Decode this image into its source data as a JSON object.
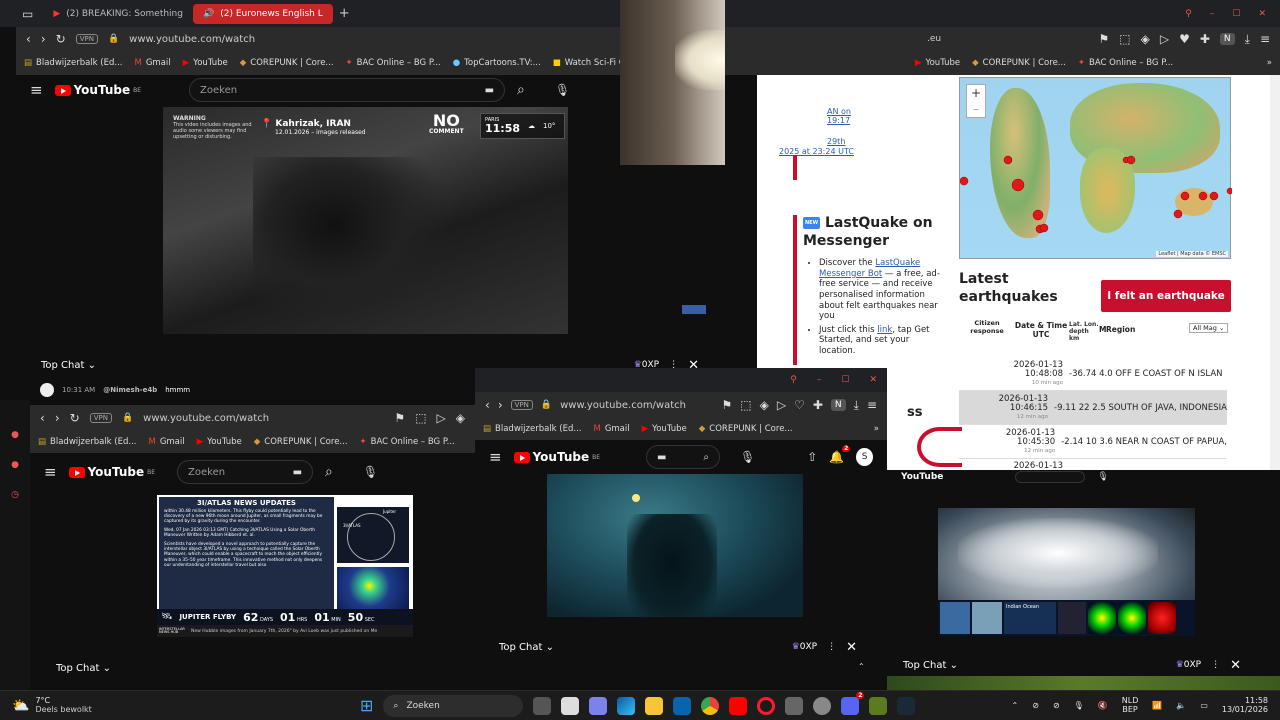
{
  "top_left": {
    "tabs": [
      {
        "label": "(2) BREAKING: Something"
      },
      {
        "label": "(2) Euronews English L"
      }
    ],
    "new_tab": "+",
    "url": "www.youtube.com/watch",
    "vpn": "VPN",
    "bookmarks": [
      "Bladwijzerbalk (Ed...",
      "Gmail",
      "YouTube",
      "COREPUNK | Core...",
      "BAC Online – BG P...",
      "TopCartoons.TV:...",
      "Watch Sci-Fi Carto"
    ],
    "search_placeholder": "Zoeken",
    "country": "BE",
    "video": {
      "warning_title": "WARNING",
      "warning_text": "This video includes images and audio some viewers may find upsetting or disturbing.",
      "location": "Kahrizak, IRAN",
      "date": "12.01.2026 – images released",
      "brand_top": "NO",
      "brand_bottom": "COMMENT",
      "city": "PARIS",
      "time": "11:58",
      "temp": "10°"
    },
    "chat": {
      "label": "Top Chat",
      "xp": "0XP",
      "time": "10:31 AM",
      "user": "@Nimesh-e4b",
      "message": "hmmm"
    }
  },
  "right_window": {
    "url_tail": ".eu",
    "bookmarks": [
      "YouTube",
      "COREPUNK | Core...",
      "BAC Online – BG P..."
    ],
    "profile_initial": "N",
    "links": [
      "AN on",
      "19:17",
      "29th",
      "2025 at 23:24 UTC"
    ],
    "messenger_badge": "NEW",
    "messenger_title": "LastQuake on Messenger",
    "bullets": [
      {
        "pre": "Discover the ",
        "link": "LastQuake Messenger Bot",
        "post": " — a free, ad-free service — and receive personalised information about felt earthquakes near you"
      },
      {
        "pre": "Just click this ",
        "link": "link",
        "post": ", tap Get Started, and set your location."
      }
    ],
    "map_attrib": "Leaflet | Map data © EMSC",
    "latest_title": "Latest earthquakes",
    "felt_button": "I felt an earthquake",
    "columns": [
      "Citizen response",
      "Date & Time UTC",
      "Lat. Lon. depth km",
      "M",
      "Region"
    ],
    "filter": "All Mag",
    "rows": [
      {
        "date": "2026-01-13",
        "time": "10:48:08",
        "ago": "10 min ago",
        "vals": "-36.74 4.0 OFF E COAST OF N ISLAN"
      },
      {
        "date": "2026-01-13",
        "time": "10:46:15",
        "ago": "12 min ago",
        "vals": "-9.11 22 2.5 SOUTH OF JAVA, INDONESIA"
      },
      {
        "date": "2026-01-13",
        "time": "10:45:30",
        "ago": "12 min ago",
        "vals": "-2.14 10 3.6 NEAR N COAST OF PAPUA,"
      },
      {
        "date": "2026-01-13",
        "time": "",
        "ago": "",
        "vals": ""
      }
    ],
    "partial_heading": "ss"
  },
  "bottom_left": {
    "url": "www.youtube.com/watch",
    "vpn": "VPN",
    "bookmarks": [
      "Bladwijzerbalk (Ed...",
      "Gmail",
      "YouTube",
      "COREPUNK | Core...",
      "BAC Online – BG P..."
    ],
    "search_placeholder": "Zoeken",
    "country": "BE",
    "video": {
      "heading": "3I/ATLAS NEWS UPDATES",
      "para1": "within 30.48 million kilometers. This flyby could potentially lead to the discovery of a new 96th moon around Jupiter, as small fragments may be captured by its gravity during the encounter.",
      "para2": "Wed, 07 Jan 2026 03:13 GMT) Catching 3I/ATLAS Using a Solar Oberth Maneuver Written by Adam Hibberd et. al.",
      "para3": "Scientists have developed a novel approach to potentially capture the interstellar object 3I/ATLAS by using a technique called the Solar Oberth Maneuver, which could enable a spacecraft to reach the object efficiently within a 35–50 year timeframe. This innovative method not only deepens our understanding of interstellar travel but also",
      "label_jupiter": "Jupiter",
      "label_atlas": "3I/ATLAS",
      "flyby": "JUPITER FLYBY",
      "days": "62",
      "days_unit": "DAYS",
      "hrs": "01",
      "hrs_unit": "HRS",
      "min": "01",
      "min_unit": "MIN",
      "sec": "50",
      "sec_unit": "SEC",
      "ticker_brand": "INTERSTELLAR NEWS HUB",
      "ticker": "New Hubble images from January 7th, 2026\" by Avi Loeb was just published on Me"
    },
    "chat_label": "Top Chat"
  },
  "bottom_mid": {
    "url": "www.youtube.com/watch",
    "vpn": "VPN",
    "bookmarks": [
      "Bladwijzerbalk (Ed...",
      "Gmail",
      "YouTube",
      "COREPUNK | Core..."
    ],
    "profile_initial": "N",
    "notif_count": "2",
    "avatar": "S",
    "chat_label": "Top Chat",
    "xp": "0XP"
  },
  "bottom_right": {
    "video_labels": [
      "Indian Ocean"
    ],
    "chat_label": "Top Chat",
    "xp": "0XP"
  },
  "taskbar": {
    "weather_temp": "7°C",
    "weather_desc": "Deels bewolkt",
    "search": "Zoeken",
    "lang1": "NLD",
    "lang2": "BEP",
    "time": "11:58",
    "date": "13/01/2026",
    "badge": "2"
  },
  "colors": {
    "accent": "#ff0000",
    "emsc_red": "#c8102e",
    "chrome_bg": "#202124"
  }
}
